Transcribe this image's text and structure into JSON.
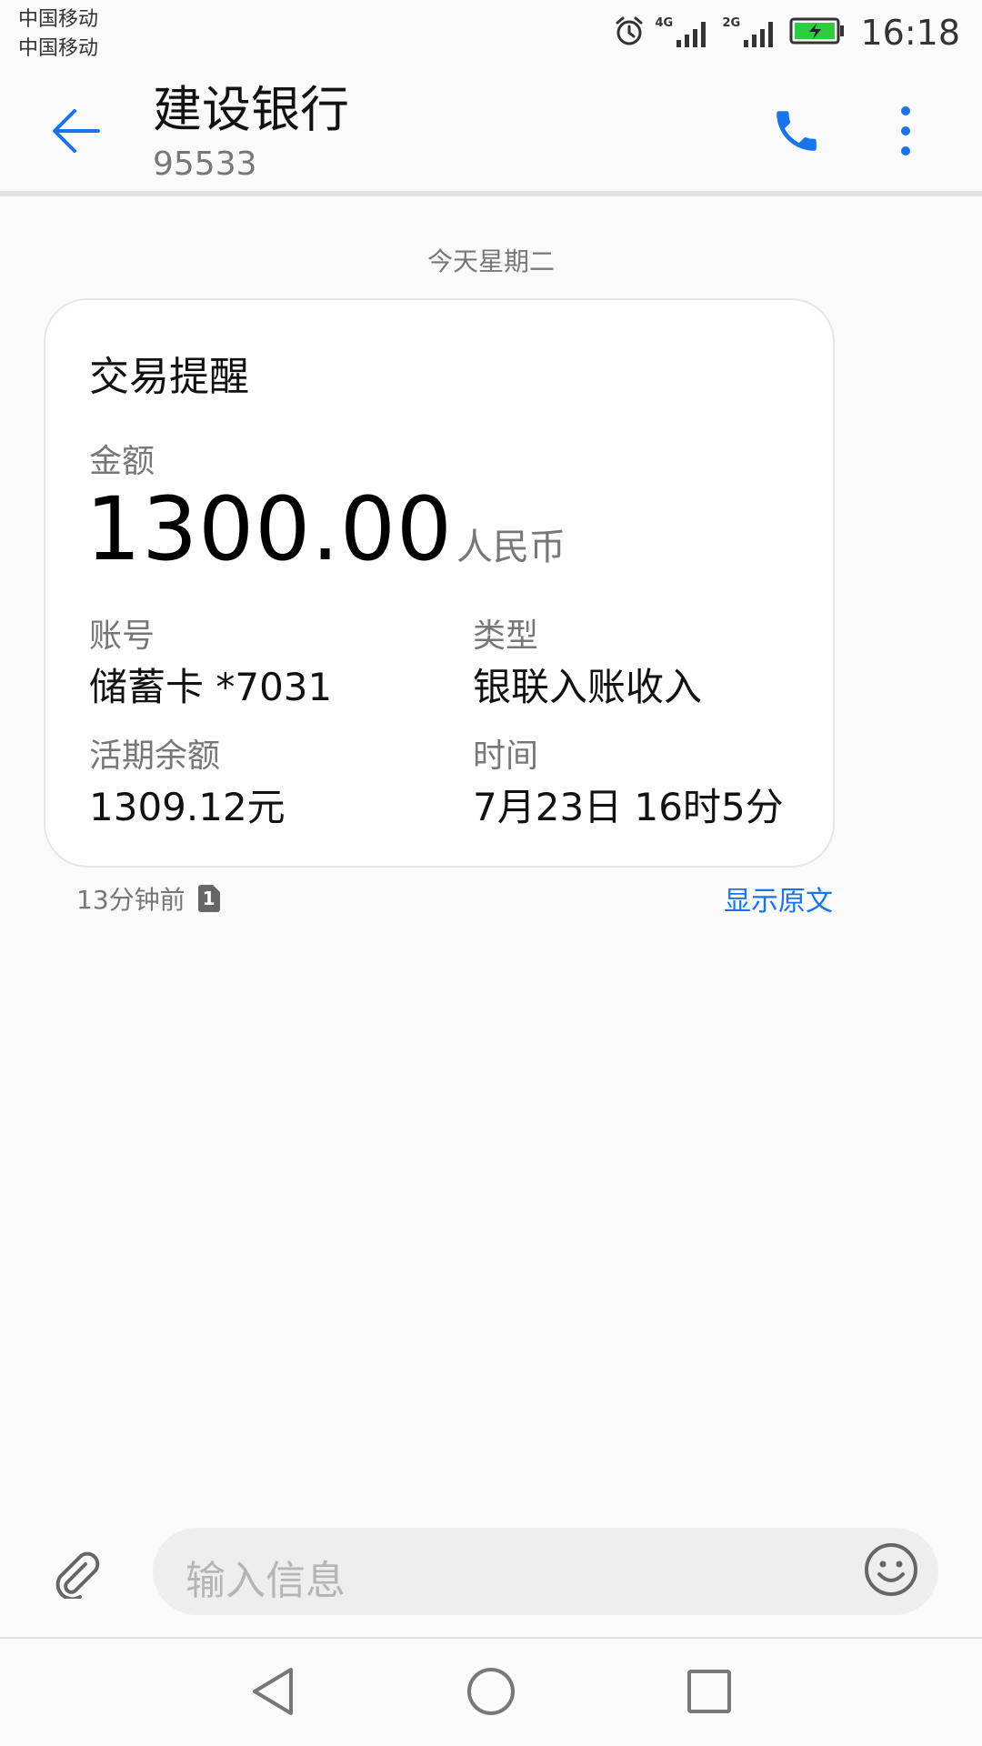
{
  "status_bar": {
    "carrier_1": "中国移动",
    "carrier_2": "中国移动",
    "network_1": "4G",
    "network_2": "2G",
    "time": "16:18",
    "icons": [
      "alarm-icon",
      "signal-icon",
      "signal-icon",
      "battery-charging-icon"
    ]
  },
  "header": {
    "contact_name": "建设银行",
    "contact_number": "95533",
    "icons": [
      "back-arrow-icon",
      "phone-icon",
      "more-vertical-icon"
    ]
  },
  "conversation": {
    "date_separator": "今天星期二",
    "card": {
      "title": "交易提醒",
      "amount_label": "金额",
      "amount_value": "1300.00",
      "amount_unit": "人民币",
      "account_label": "账号",
      "account_value": "储蓄卡 *7031",
      "type_label": "类型",
      "type_value": "银联入账收入",
      "balance_label": "活期余额",
      "balance_value": "1309.12元",
      "time_label": "时间",
      "time_value": "7月23日 16时5分"
    },
    "received": "13分钟前",
    "sim_slot": "1",
    "show_original": "显示原文"
  },
  "composer": {
    "placeholder": "输入信息",
    "icons": [
      "paperclip-icon",
      "emoji-icon"
    ]
  },
  "colors": {
    "accent": "#1a73e8",
    "background": "#fafafa",
    "battery": "#2ecc40"
  }
}
